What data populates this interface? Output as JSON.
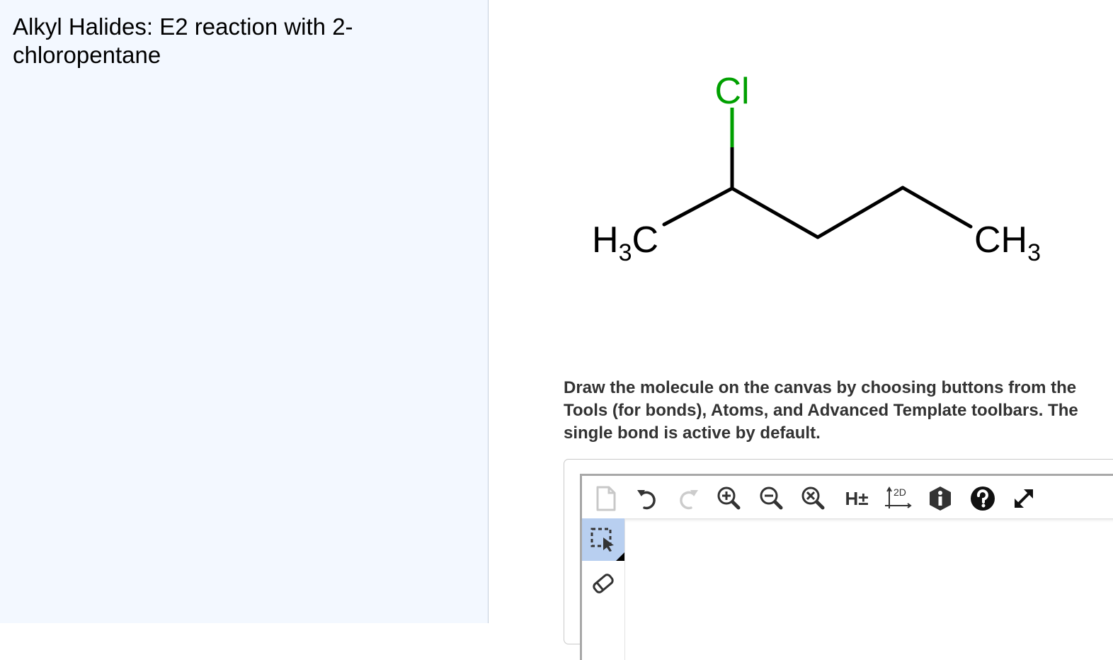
{
  "left": {
    "title": "Alkyl Halides: E2 reaction with 2-chloropentane"
  },
  "molecule": {
    "chlorine_label": "Cl",
    "left_methyl": {
      "main": "H",
      "sub": "3",
      "tail": "C"
    },
    "right_methyl": {
      "main": "CH",
      "sub": "3"
    },
    "colors": {
      "bond": "#000000",
      "chlorine": "#00a000"
    }
  },
  "instructions": "Draw the molecule on the canvas by choosing buttons from the Tools (for bonds), Atoms, and Advanced Template toolbars. The single bond is active by default.",
  "toolbar": {
    "icons": [
      "new-document-icon",
      "undo-icon",
      "redo-icon",
      "zoom-in-icon",
      "zoom-out-icon",
      "zoom-reset-icon",
      "toggle-hydrogens",
      "clean-2d-icon",
      "info-icon",
      "help-icon",
      "fullscreen-icon"
    ],
    "hydrogens_label": "H±",
    "clean_label": "2D"
  },
  "side_toolbar": {
    "icons": [
      "selection-tool-icon",
      "eraser-icon"
    ]
  }
}
